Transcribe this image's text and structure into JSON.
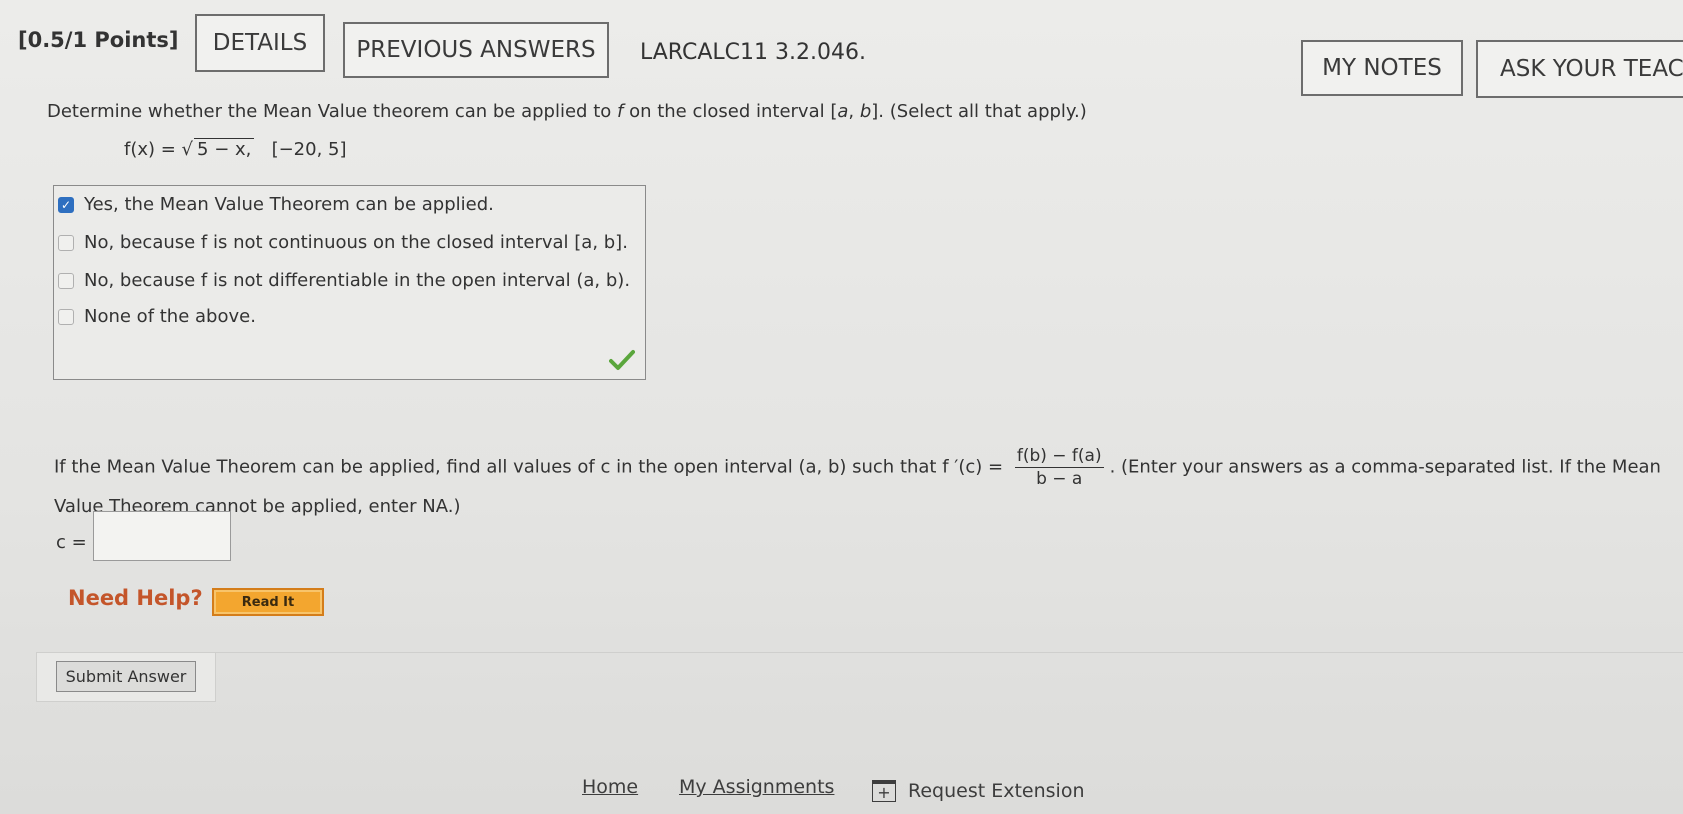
{
  "header": {
    "points": "[0.5/1 Points]",
    "details_label": "DETAILS",
    "previous_answers_label": "PREVIOUS ANSWERS",
    "problem_code": "LARCALC11 3.2.046.",
    "my_notes_label": "MY NOTES",
    "ask_teacher_label": "ASK YOUR TEACH"
  },
  "question": {
    "prompt_part1": "Determine whether the Mean Value theorem can be applied to ",
    "f": "f",
    "prompt_part2": " on the closed interval [",
    "a": "a",
    "sep": ", ",
    "b": "b",
    "prompt_part3": "]. (Select all that apply.)",
    "formula_lhs": "f(x) = √",
    "formula_radicand": "5 − x,",
    "formula_interval": "[−20, 5]"
  },
  "choices": [
    {
      "label": "Yes, the Mean Value Theorem can be applied.",
      "checked": true
    },
    {
      "label": "No, because f is not continuous on the closed interval [a, b].",
      "checked": false
    },
    {
      "label": "No, because f is not differentiable in the open interval (a, b).",
      "checked": false
    },
    {
      "label": "None of the above.",
      "checked": false
    }
  ],
  "mvt": {
    "text1": "If the Mean Value Theorem can be applied, find all values of c in the open interval (a, b) such that f ′(c) = ",
    "frac_num": "f(b) − f(a)",
    "frac_den": "b − a",
    "text2": ". (Enter your answers as a comma-separated list. If the Mean Value Theorem cannot be applied, enter NA.)",
    "c_label": "c =",
    "c_value": ""
  },
  "help": {
    "need_help": "Need Help?",
    "read_it": "Read It"
  },
  "submit_label": "Submit Answer",
  "footer": {
    "home": "Home",
    "my_assignments": "My Assignments",
    "request_extension": "Request Extension"
  },
  "colors": {
    "checkbox_checked": "#2e6fc0",
    "correct_check": "#5aa63c",
    "need_help": "#c4552a",
    "read_it_bg": "#f3a62f"
  }
}
